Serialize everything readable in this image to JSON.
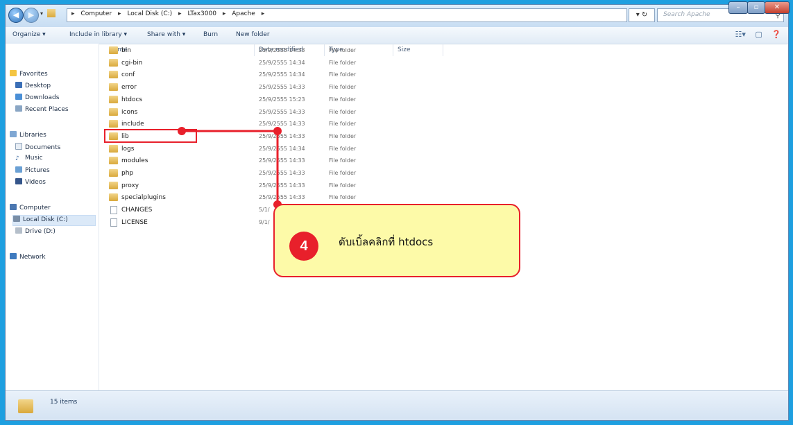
{
  "address_bar": {
    "crumbs": [
      "Computer",
      "Local Disk (C:)",
      "LTax3000",
      "Apache"
    ],
    "search_placeholder": "Search Apache",
    "refresh_icon": "refresh-icon"
  },
  "toolbar": {
    "organize": "Organize ▾",
    "include_in_library": "Include in library ▾",
    "share_with": "Share with ▾",
    "burn": "Burn",
    "new_folder": "New folder"
  },
  "nav": {
    "favorites": "Favorites",
    "desktop": "Desktop",
    "downloads": "Downloads",
    "recent_places": "Recent Places",
    "libraries": "Libraries",
    "documents": "Documents",
    "music": "Music",
    "pictures": "Pictures",
    "videos": "Videos",
    "computer": "Computer",
    "local_disk": "Local Disk (C:)",
    "drive_d": "Drive (D:)",
    "network": "Network"
  },
  "columns": {
    "name": "Name",
    "date_modified": "Date modified",
    "type": "Type",
    "size": "Size"
  },
  "files": [
    {
      "name": "bin",
      "date": "25/9/2555 14:33",
      "type": "File folder",
      "kind": "folder"
    },
    {
      "name": "cgi-bin",
      "date": "25/9/2555 14:34",
      "type": "File folder",
      "kind": "folder"
    },
    {
      "name": "conf",
      "date": "25/9/2555 14:34",
      "type": "File folder",
      "kind": "folder"
    },
    {
      "name": "error",
      "date": "25/9/2555 14:33",
      "type": "File folder",
      "kind": "folder"
    },
    {
      "name": "htdocs",
      "date": "25/9/2555 15:23",
      "type": "File folder",
      "kind": "folder"
    },
    {
      "name": "icons",
      "date": "25/9/2555 14:33",
      "type": "File folder",
      "kind": "folder"
    },
    {
      "name": "include",
      "date": "25/9/2555 14:33",
      "type": "File folder",
      "kind": "folder"
    },
    {
      "name": "lib",
      "date": "25/9/2555 14:33",
      "type": "File folder",
      "kind": "folder"
    },
    {
      "name": "logs",
      "date": "25/9/2555 14:34",
      "type": "File folder",
      "kind": "folder"
    },
    {
      "name": "modules",
      "date": "25/9/2555 14:33",
      "type": "File folder",
      "kind": "folder"
    },
    {
      "name": "php",
      "date": "25/9/2555 14:33",
      "type": "File folder",
      "kind": "folder"
    },
    {
      "name": "proxy",
      "date": "25/9/2555 14:33",
      "type": "File folder",
      "kind": "folder"
    },
    {
      "name": "specialplugins",
      "date": "25/9/2555 14:33",
      "type": "File folder",
      "kind": "folder"
    },
    {
      "name": "CHANGES",
      "date": "5/1/",
      "type": "",
      "kind": "doc"
    },
    {
      "name": "LICENSE",
      "date": "9/1/",
      "type": "",
      "kind": "doc"
    }
  ],
  "status": {
    "items": "15 items"
  },
  "callout": {
    "number": "4",
    "text": "ดับเบิ้ลคลิกที่  htdocs"
  },
  "colors": {
    "window_border": "#1e9fe0",
    "annotation_red": "#e8202b",
    "callout_fill": "#fdfaa8"
  }
}
